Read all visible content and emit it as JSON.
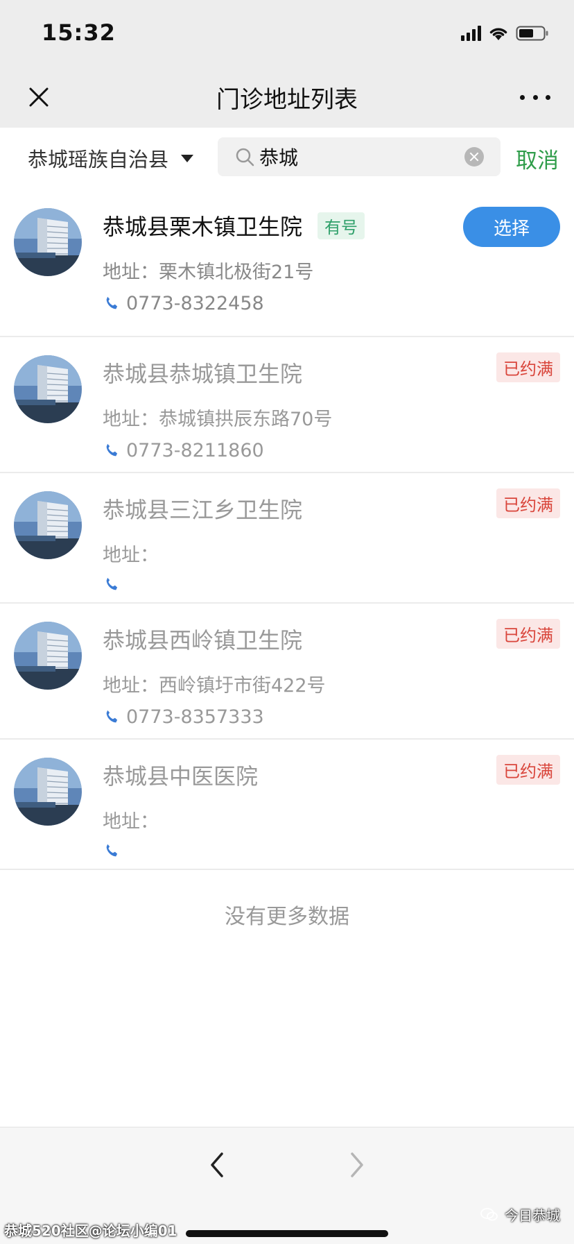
{
  "status_bar": {
    "time": "15:32",
    "icons": [
      "signal-icon",
      "wifi-icon",
      "battery-icon"
    ]
  },
  "nav": {
    "title": "门诊地址列表",
    "close_icon": "close-icon",
    "more_icon": "more-icon"
  },
  "search": {
    "region": "恭城瑶族自治县",
    "value": "恭城",
    "cancel_label": "取消"
  },
  "clinics": [
    {
      "name": "恭城县栗木镇卫生院",
      "tag": "有号",
      "action_label": "选择",
      "address": "地址：栗木镇北极街21号",
      "phone": "0773-8322458"
    },
    {
      "name": "恭城县恭城镇卫生院",
      "status": "已约满",
      "address": "地址：恭城镇拱辰东路70号",
      "phone": "0773-8211860"
    },
    {
      "name": "恭城县三江乡卫生院",
      "status": "已约满",
      "address": "地址：",
      "phone": ""
    },
    {
      "name": "恭城县西岭镇卫生院",
      "status": "已约满",
      "address": "地址：西岭镇圩市街422号",
      "phone": "0773-8357333"
    },
    {
      "name": "恭城县中医医院",
      "status": "已约满",
      "address": "地址：",
      "phone": ""
    }
  ],
  "footer": {
    "no_more": "没有更多数据"
  },
  "watermarks": {
    "left": "恭城520社区@论坛小编01",
    "right": "今日恭城"
  },
  "colors": {
    "accent_green": "#2f9d4a",
    "select_blue": "#3a8fe6",
    "full_red": "#d9453b",
    "tag_green": "#2fa06a",
    "phone_blue": "#3a7bd5"
  }
}
